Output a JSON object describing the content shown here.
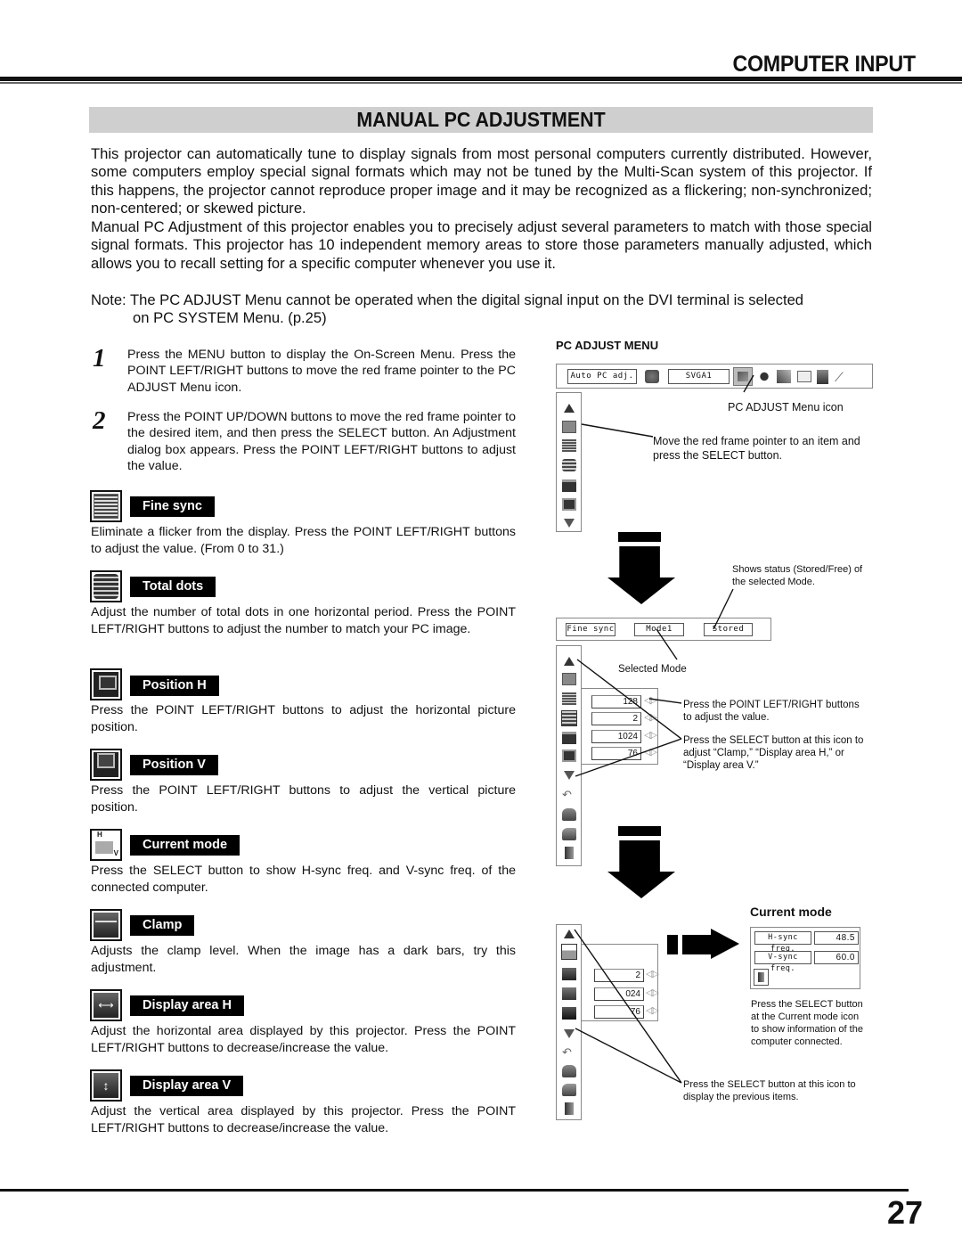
{
  "header": {
    "chapter": "COMPUTER INPUT",
    "section": "MANUAL PC ADJUSTMENT"
  },
  "intro": {
    "p1": "This projector can automatically tune to display signals from most personal computers currently distributed. However, some computers employ special signal formats which may not be tuned by the Multi-Scan system of this projector. If this happens, the projector cannot reproduce proper image and it may be recognized as a flickering; non-synchronized; non-centered; or skewed picture.",
    "p2": "Manual PC Adjustment of this projector enables you to precisely adjust several parameters to match with those special signal formats. This projector has 10 independent memory areas to store those parameters manually adjusted, which allows you to recall setting for a specific computer whenever you use it.",
    "note_line1": "Note: The PC ADJUST Menu cannot be operated when the digital signal input on the DVI terminal is selected",
    "note_line2": "on PC SYSTEM Menu. (p.25)"
  },
  "steps": [
    {
      "num": "1",
      "text": "Press the MENU button to display the On-Screen Menu. Press the POINT LEFT/RIGHT buttons to move the red frame pointer to the PC ADJUST Menu icon."
    },
    {
      "num": "2",
      "text": "Press the POINT UP/DOWN buttons to move the red frame pointer to the desired item, and then press the SELECT button.  An Adjustment dialog box appears. Press the POINT LEFT/RIGHT buttons to adjust the value."
    }
  ],
  "items": [
    {
      "icon": "fine-sync-icon",
      "label": "Fine sync",
      "desc": "Eliminate a flicker from the display. Press the POINT LEFT/RIGHT buttons to adjust the value. (From 0 to 31.)"
    },
    {
      "icon": "total-dots-icon",
      "label": "Total dots",
      "desc": "Adjust the number of total dots in one horizontal period. Press the POINT LEFT/RIGHT buttons to adjust the number to match your PC image."
    },
    {
      "icon": "position-h-icon",
      "label": "Position H",
      "desc": "Press the POINT LEFT/RIGHT buttons to adjust the horizontal picture position."
    },
    {
      "icon": "position-v-icon",
      "label": "Position V",
      "desc": "Press the POINT LEFT/RIGHT buttons to adjust the vertical picture position."
    },
    {
      "icon": "current-mode-icon",
      "label": "Current mode",
      "desc": "Press the SELECT button to show H-sync freq. and V-sync freq. of the connected computer."
    },
    {
      "icon": "clamp-icon",
      "label": "Clamp",
      "desc": "Adjusts the clamp level. When the image has a dark bars, try this adjustment."
    },
    {
      "icon": "display-area-h-icon",
      "label": "Display area H",
      "desc": "Adjust the horizontal area displayed by this projector. Press the POINT LEFT/RIGHT buttons to decrease/increase the value."
    },
    {
      "icon": "display-area-v-icon",
      "label": "Display area V",
      "desc": "Adjust the vertical area displayed by this projector. Press the POINT LEFT/RIGHT buttons to decrease/increase the value."
    }
  ],
  "diagram": {
    "title": "PC ADJUST MENU",
    "menubar": {
      "auto": "Auto PC adj.",
      "mode": "SVGA1"
    },
    "callout_icon": "PC ADJUST Menu icon",
    "callout_move": "Move the red frame pointer to an item and press the SELECT button.",
    "callout_status": "Shows status (Stored/Free) of the selected Mode.",
    "bar2": {
      "item": "Fine sync",
      "mode": "Mode1",
      "status": "Stored"
    },
    "callout_selected_mode": "Selected Mode",
    "values1": [
      "128",
      "2",
      "1024",
      "76"
    ],
    "callout_lr": "Press the POINT LEFT/RIGHT buttons to adjust the value.",
    "callout_select_icon": "Press the SELECT button at this icon to adjust “Clamp,” “Display area H,” or “Display area V.”",
    "values2": [
      "2",
      "024",
      "76"
    ],
    "current_mode_title": "Current mode",
    "hsync_label": "H-sync freq.",
    "hsync_value": "48.5",
    "vsync_label": "V-sync freq.",
    "vsync_value": "60.0",
    "callout_current": "Press the SELECT button at the Current mode icon to show information of the computer connected.",
    "callout_previous": "Press the SELECT button at this icon to display the previous items."
  },
  "footer": {
    "page": "27"
  }
}
